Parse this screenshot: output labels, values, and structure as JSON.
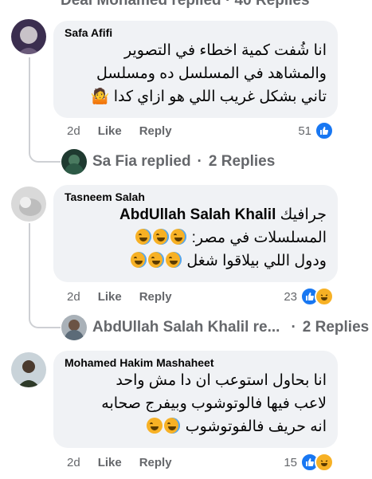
{
  "top_fragment": "Deal Mohamed replied · 40 Replies",
  "comments": [
    {
      "author": "Safa Afifi",
      "lines": [
        "انا شُفت كمية اخطاء في التصوير",
        "والمشاهد في المسلسل ده ومسلسل",
        "تاني بشكل غريب اللي هو ازاي كدا 🤷"
      ],
      "time": "2d",
      "like_label": "Like",
      "reply_label": "Reply",
      "reaction_count": "51",
      "reactions": [
        "like"
      ],
      "replies": {
        "name": "Sa Fia replied",
        "count": "2 Replies"
      }
    },
    {
      "author": "Tasneem Salah",
      "mention": "AbdUllah Salah Khalil",
      "lines": [
        "جرافيك",
        "المسلسلات في مصر:",
        "ودول اللي بيلاقوا شغل"
      ],
      "time": "2d",
      "like_label": "Like",
      "reply_label": "Reply",
      "reaction_count": "23",
      "reactions": [
        "like",
        "haha"
      ],
      "replies": {
        "name": "AbdUllah Salah Khalil re...",
        "count": "2 Replies"
      }
    },
    {
      "author": "Mohamed Hakim Mashaheet",
      "lines": [
        "انا بحاول استوعب ان دا مش واحد",
        "لاعب فيها فالوتوشوب وبيفرج صحابه",
        "انه حريف فالفوتوشوب"
      ],
      "time": "2d",
      "like_label": "Like",
      "reply_label": "Reply",
      "reaction_count": "15",
      "reactions": [
        "like",
        "haha"
      ]
    }
  ],
  "colors": {
    "like": "#1877f2",
    "haha": "#f7b125",
    "bubble": "#f0f2f5",
    "meta": "#65676b"
  }
}
